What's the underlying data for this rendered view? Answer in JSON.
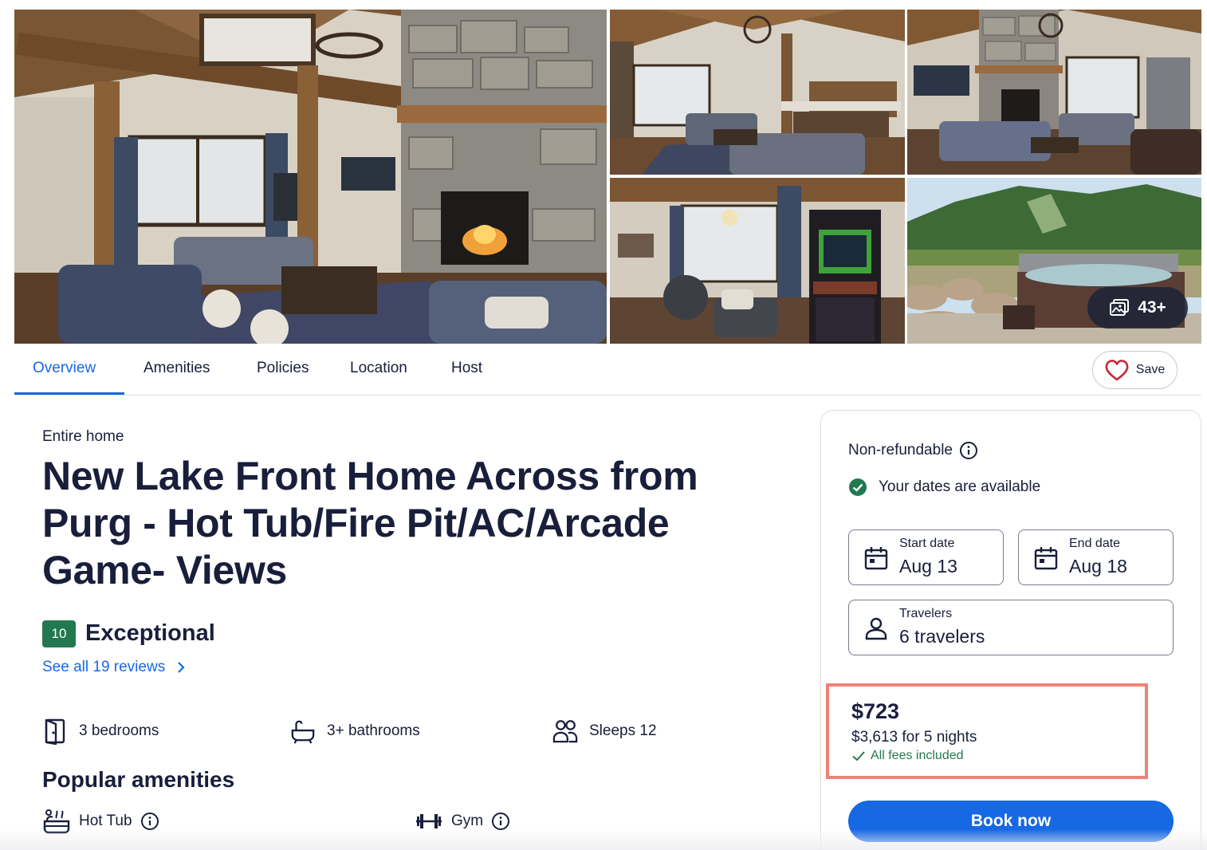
{
  "gallery": {
    "photos": [
      {
        "name": "living-room-fireplace-photo"
      },
      {
        "name": "open-kitchen-living-photo"
      },
      {
        "name": "living-room-tv-photo"
      },
      {
        "name": "arcade-game-room-photo"
      },
      {
        "name": "hot-tub-mountain-view-photo"
      }
    ],
    "more_count": "43+",
    "more_icon": "photo-gallery-icon"
  },
  "tabs": [
    {
      "label": "Overview",
      "active": true
    },
    {
      "label": "Amenities",
      "active": false
    },
    {
      "label": "Policies",
      "active": false
    },
    {
      "label": "Location",
      "active": false
    },
    {
      "label": "Host",
      "active": false
    }
  ],
  "save": {
    "label": "Save",
    "icon": "heart-icon"
  },
  "property": {
    "type": "Entire home",
    "title": "New Lake Front Home Across from Purg - Hot Tub/Fire Pit/AC/Arcade Game- Views",
    "rating_score": "10",
    "rating_label": "Exceptional",
    "reviews_link": "See all 19 reviews"
  },
  "facts": {
    "bedrooms": "3 bedrooms",
    "bathrooms": "3+ bathrooms",
    "sleeps": "Sleeps 12"
  },
  "amenities": {
    "heading": "Popular amenities",
    "items": [
      {
        "label": "Hot Tub",
        "icon": "hot-tub-icon"
      },
      {
        "label": "Gym",
        "icon": "dumbbell-icon"
      }
    ]
  },
  "booking": {
    "refund_policy": "Non-refundable",
    "availability": "Your dates are available",
    "start_label": "Start date",
    "start_value": "Aug 13",
    "end_label": "End date",
    "end_value": "Aug 18",
    "travelers_label": "Travelers",
    "travelers_value": "6 travelers",
    "price_per_night": "$723",
    "price_total": "$3,613 for 5 nights",
    "fees_note": "All fees included",
    "book_label": "Book now"
  },
  "colors": {
    "accent": "#1668e3",
    "rating_green": "#227950",
    "highlight_border": "#ee8277",
    "heart_red": "#c9263a",
    "text": "#191e3b"
  }
}
